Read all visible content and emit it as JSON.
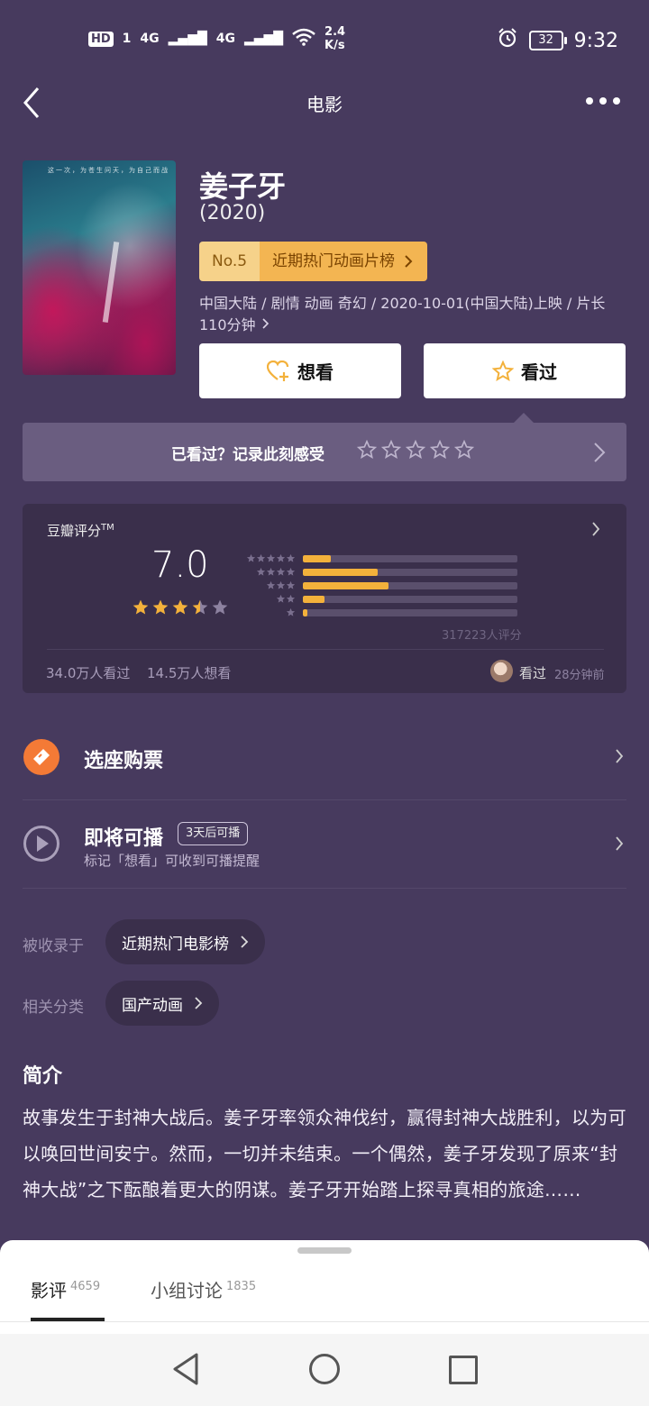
{
  "status_bar": {
    "hd": "HD",
    "hd_sub": "1",
    "signal1": "4G",
    "signal2": "4G",
    "net_speed_value": "2.4",
    "net_speed_unit": "K/s",
    "battery": "32",
    "time": "9:32"
  },
  "nav": {
    "title": "电影"
  },
  "movie": {
    "title": "姜子牙",
    "year": "(2020)",
    "rank_no": "No.5",
    "rank_list": "近期热门动画片榜",
    "meta": "中国大陆 / 剧情 动画 奇幻 / 2020-10-01(中国大陆)上映 / 片长110分钟",
    "poster_tagline": "这一次，为苍生问天，为自己而战"
  },
  "actions": {
    "want": "想看",
    "seen": "看过"
  },
  "record": {
    "prompt": "已看过？记录此刻感受"
  },
  "rating": {
    "label": "豆瓣评分",
    "tm": "TM",
    "score": "7.0",
    "stars_value": 3.5,
    "distribution": [
      {
        "stars": 5,
        "fraction": 0.13
      },
      {
        "stars": 4,
        "fraction": 0.35
      },
      {
        "stars": 3,
        "fraction": 0.4
      },
      {
        "stars": 2,
        "fraction": 0.1
      },
      {
        "stars": 1,
        "fraction": 0.02
      }
    ],
    "total": "317223人评分",
    "seen_count": "34.0万人看过",
    "want_count": "14.5万人想看",
    "friend_action": "看过",
    "friend_time": "28分钟前"
  },
  "rows": {
    "tickets": "选座购票",
    "coming": "即将可播",
    "coming_badge": "3天后可播",
    "coming_sub": "标记「想看」可收到可播提醒"
  },
  "collected": {
    "label": "被收录于",
    "value": "近期热门电影榜"
  },
  "category": {
    "label": "相关分类",
    "value": "国产动画"
  },
  "intro": {
    "heading": "简介",
    "text": "故事发生于封神大战后。姜子牙率领众神伐纣，赢得封神大战胜利，以为可以唤回世间安宁。然而，一切并未结束。一个偶然，姜子牙发现了原来“封神大战”之下酝酿着更大的阴谋。姜子牙开始踏上探寻真相的旅途……"
  },
  "tabs": [
    {
      "label": "影评",
      "count": "4659"
    },
    {
      "label": "小组讨论",
      "count": "1835"
    }
  ],
  "colors": {
    "background": "#473a5e",
    "accent": "#f3b13b",
    "card": "#3a2f4b"
  }
}
